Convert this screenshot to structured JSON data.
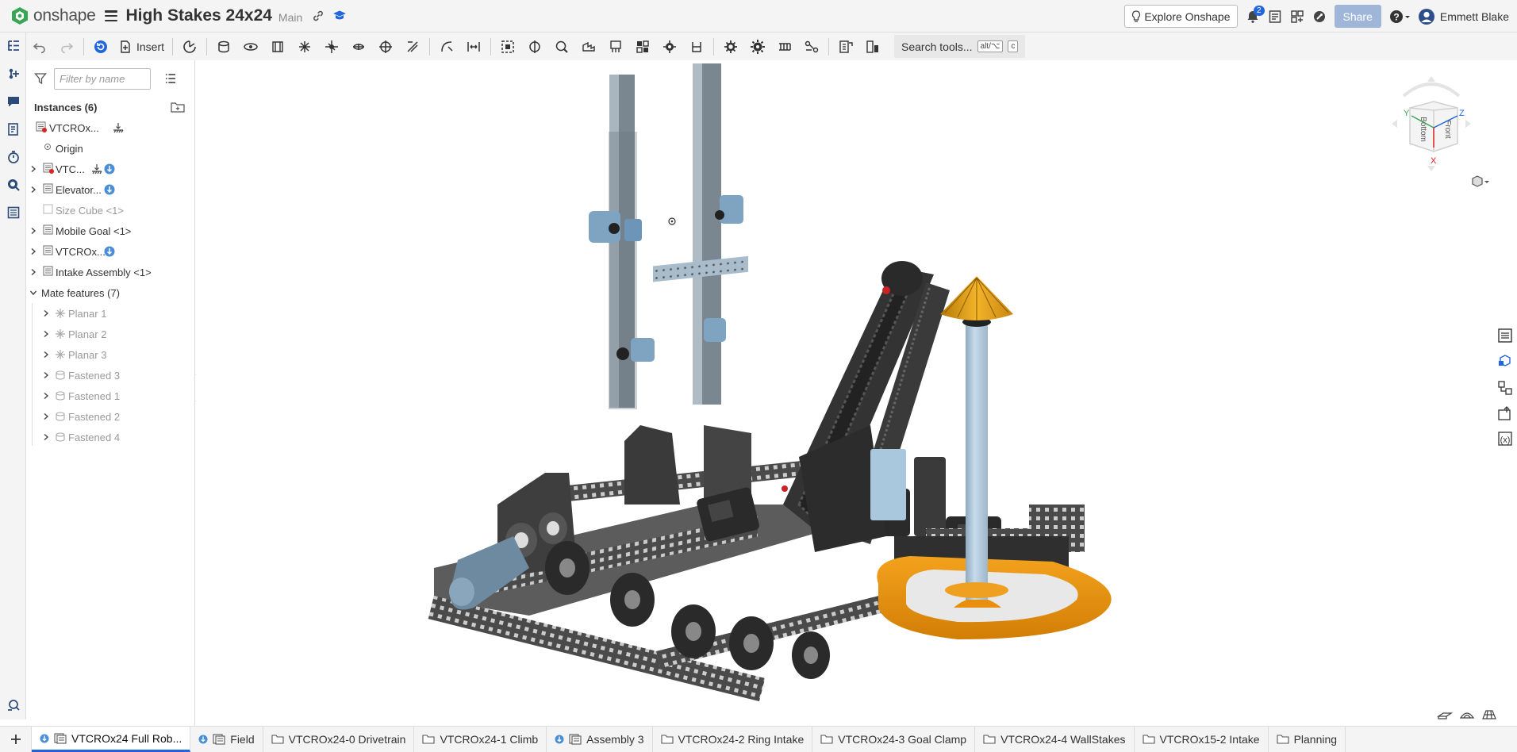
{
  "app": {
    "brand": "onshape",
    "doc_title": "High Stakes 24x24",
    "branch": "Main"
  },
  "topbar": {
    "explore_label": "Explore Onshape",
    "notif_count": "2",
    "share_label": "Share",
    "user_name": "Emmett Blake"
  },
  "toolbar": {
    "insert_label": "Insert",
    "search_label": "Search tools...",
    "shortcut_mod": "alt/⌥",
    "shortcut_key": "c"
  },
  "panel": {
    "filter_placeholder": "Filter by name",
    "instances_header": "Instances (6)",
    "items": [
      {
        "label": "VTCROx...",
        "level": 0,
        "expandable": false,
        "dim": false
      },
      {
        "label": "Origin",
        "level": 1,
        "expandable": false,
        "dim": false
      },
      {
        "label": "VTC...",
        "level": 0,
        "expandable": true,
        "dim": false
      },
      {
        "label": "Elevator...",
        "level": 0,
        "expandable": true,
        "dim": false
      },
      {
        "label": "Size Cube <1>",
        "level": 0,
        "expandable": false,
        "dim": true
      },
      {
        "label": "Mobile Goal <1>",
        "level": 0,
        "expandable": true,
        "dim": false
      },
      {
        "label": "VTCROx...",
        "level": 0,
        "expandable": true,
        "dim": false
      },
      {
        "label": "Intake Assembly <1>",
        "level": 0,
        "expandable": true,
        "dim": false
      }
    ],
    "mates_header": "Mate features (7)",
    "mates": [
      "Planar 1",
      "Planar 2",
      "Planar 3",
      "Fastened 3",
      "Fastened 1",
      "Fastened 2",
      "Fastened 4"
    ]
  },
  "viewcube": {
    "top": "Y",
    "z": "Z",
    "x": "X",
    "bottom_face": "Bottom",
    "front_face": "Front"
  },
  "tabs": [
    {
      "label": "VTCROx24 Full Rob...",
      "active": true,
      "icon": "assembly"
    },
    {
      "label": "Field",
      "active": false,
      "icon": "assembly"
    },
    {
      "label": "VTCROx24-0 Drivetrain",
      "active": false,
      "icon": "folder"
    },
    {
      "label": "VTCROx24-1 Climb",
      "active": false,
      "icon": "folder"
    },
    {
      "label": "Assembly 3",
      "active": false,
      "icon": "assembly"
    },
    {
      "label": "VTCROx24-2 Ring Intake",
      "active": false,
      "icon": "folder"
    },
    {
      "label": "VTCROx24-3 Goal Clamp",
      "active": false,
      "icon": "folder"
    },
    {
      "label": "VTCROx24-4 WallStakes",
      "active": false,
      "icon": "folder"
    },
    {
      "label": "VTCROx15-2 Intake",
      "active": false,
      "icon": "folder"
    },
    {
      "label": "Planning",
      "active": false,
      "icon": "folder"
    }
  ],
  "colors": {
    "accent": "#2266dd",
    "brand_green": "#3aa655",
    "goal_orange": "#e8900d",
    "robot_dark": "#3a3a3a",
    "robot_blue": "#a9c7dd"
  }
}
